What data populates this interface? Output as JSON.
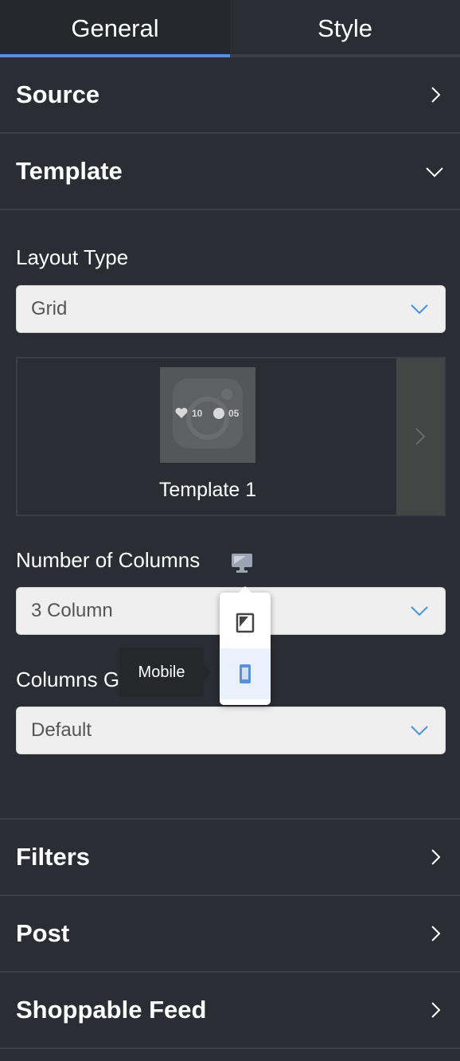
{
  "tabs": {
    "general": "General",
    "style": "Style"
  },
  "sections": {
    "source": "Source",
    "template": "Template",
    "filters": "Filters",
    "post": "Post",
    "shoppable": "Shoppable Feed"
  },
  "template_panel": {
    "layout_type_label": "Layout Type",
    "layout_type_value": "Grid",
    "template_name": "Template 1",
    "thumb_likes": "10",
    "thumb_comments": "05",
    "num_columns_label": "Number of Columns",
    "num_columns_value": "3 Column",
    "columns_gap_label": "Columns Gap",
    "columns_gap_value": "Default"
  },
  "device_dropdown": {
    "items": [
      "tablet",
      "mobile"
    ],
    "selected": "mobile"
  },
  "tooltip": {
    "text": "Mobile"
  },
  "colors": {
    "accent": "#5b8fd6",
    "background": "#2b2d34"
  }
}
